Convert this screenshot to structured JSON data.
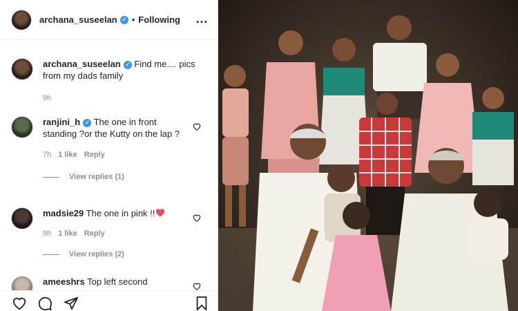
{
  "post": {
    "username": "archana_suseelan",
    "follow_status": "Following",
    "more_icon": "…",
    "caption": "Find me.... pics from my dads family",
    "time": "9h"
  },
  "comments": [
    {
      "username": "ranjini_h",
      "verified": true,
      "text": "The one in front standing ?or the Kutty on the lap ?",
      "time": "7h",
      "likes": "1 like",
      "reply": "Reply",
      "view_replies": "View replies (1)"
    },
    {
      "username": "madsie29",
      "verified": false,
      "text": "The one in pink !!",
      "has_heart_emoji": true,
      "time": "9h",
      "likes": "1 like",
      "reply": "Reply",
      "view_replies": "View replies (2)"
    },
    {
      "username": "ameeshrs",
      "verified": false,
      "text": "Top left second"
    }
  ],
  "colors": {
    "verified_blue": "#3897f0",
    "heart_red": "#ed4956",
    "text_primary": "#262626",
    "text_secondary": "#8e8e8e"
  },
  "icons": [
    "verified-badge-icon",
    "more-options-icon",
    "heart-icon",
    "comment-icon",
    "share-icon",
    "bookmark-icon"
  ]
}
